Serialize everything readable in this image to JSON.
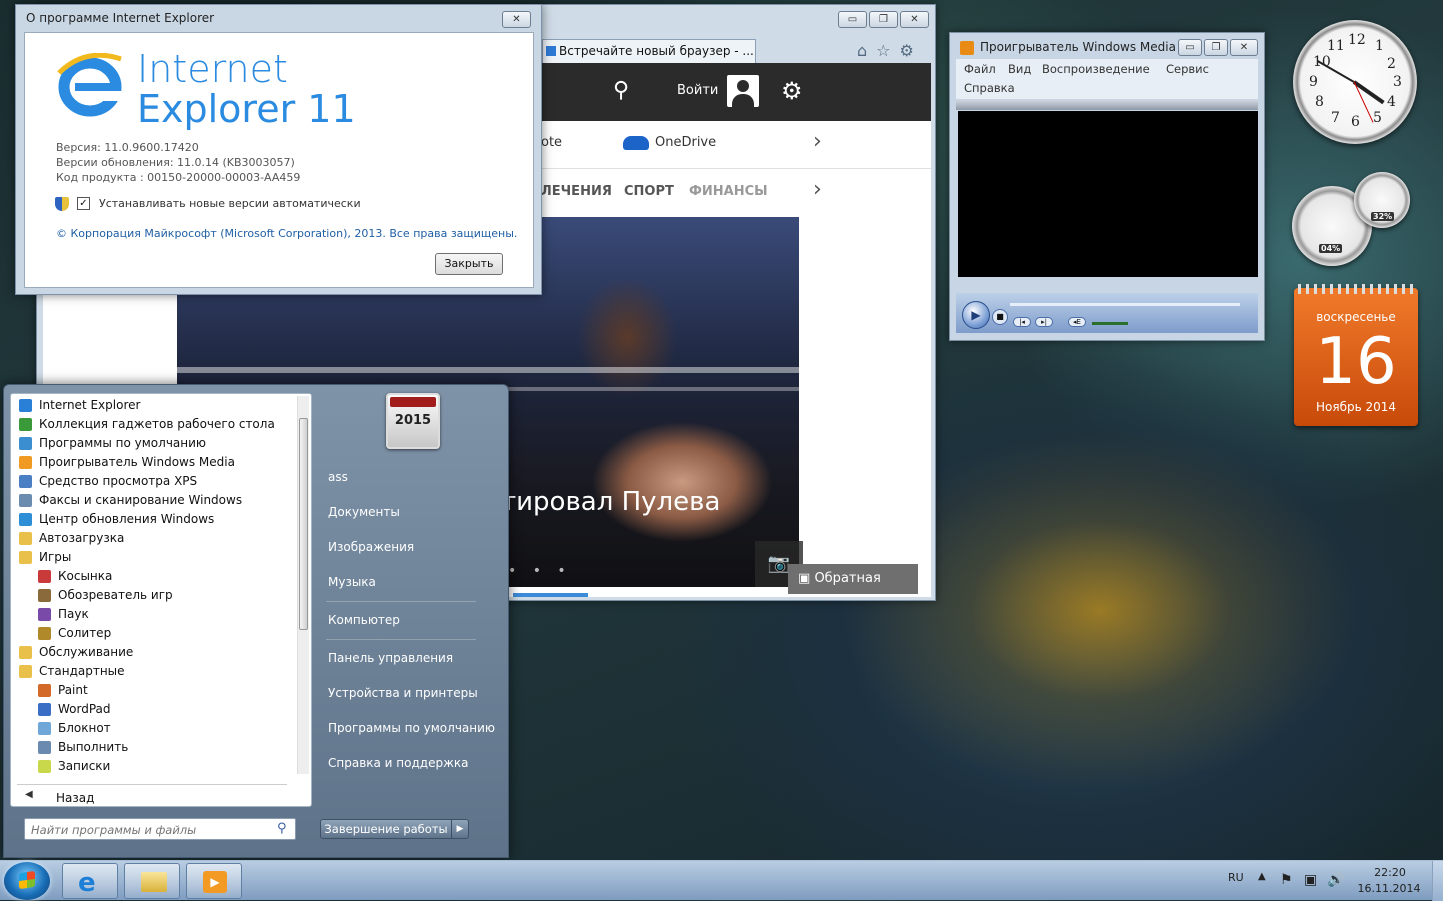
{
  "browser": {
    "tab_title": "Встречайте новый браузер - ...",
    "caption": {
      "minimize": "▭",
      "restore": "❐",
      "close": "✕"
    },
    "toolbar_icons": [
      "home-icon",
      "star-icon",
      "gear-icon"
    ],
    "toolbar_glyphs": {
      "home": "⌂",
      "favorites": "☆",
      "settings": "⚙"
    },
    "msn": {
      "search_glyph": "⚲",
      "login": "Войти",
      "settings_glyph": "⚙",
      "apps": {
        "note": "ote",
        "onedrive": "OneDrive",
        "next": "›"
      },
      "nav": {
        "entertainment": "ЛЕЧЕНИЯ",
        "sport": "СПОРТ",
        "finance": "ФИНАНСЫ",
        "next": "›"
      },
      "hero_caption": "тировал Пулева",
      "hero_dots": "• • •",
      "camera_glyph": "📷",
      "feedback": "Обратная связь",
      "feedback_glyph": "▣"
    }
  },
  "about": {
    "title": "О программе Internet Explorer",
    "close_x": "✕",
    "wordmark_line1": "Internet",
    "wordmark_line2": "Explorer 11",
    "version": "Версия: 11.0.9600.17420",
    "update_version": "Версии обновления: 11.0.14 (KB3003057)",
    "product_code": "Код продукта : 00150-20000-00003-AA459",
    "autoupdate_checked": "✓",
    "autoupdate_label": "Устанавливать новые версии автоматически",
    "copyright": "© Корпорация Майкрософт (Microsoft Corporation), 2013. Все права защищены.",
    "close_button": "Закрыть"
  },
  "wmp": {
    "title": "Проигрыватель Windows Media",
    "caption": {
      "minimize": "▭",
      "restore": "❐",
      "close": "✕"
    },
    "menu": [
      "Файл",
      "Вид",
      "Воспроизведение",
      "Сервис",
      "Справка"
    ],
    "controls": {
      "play": "▶",
      "stop": "■",
      "prev": "|◂",
      "next": "▸|",
      "mute": "◂E"
    }
  },
  "gadgets": {
    "clock_numbers": [
      "12",
      "1",
      "2",
      "3",
      "4",
      "5",
      "6",
      "7",
      "8",
      "9",
      "10",
      "11"
    ],
    "cpu_percent": "04%",
    "memory_percent": "32%",
    "calendar": {
      "weekday": "воскресенье",
      "day": "16",
      "month": "Ноябрь 2014"
    }
  },
  "start_menu": {
    "programs": [
      {
        "label": "Internet Explorer",
        "indent": 0,
        "color": "#2a7fd6"
      },
      {
        "label": "Коллекция гаджетов рабочего стола",
        "indent": 0,
        "color": "#3a9a3a"
      },
      {
        "label": "Программы по умолчанию",
        "indent": 0,
        "color": "#3b8ed0"
      },
      {
        "label": "Проигрыватель Windows Media",
        "indent": 0,
        "color": "#f09a24"
      },
      {
        "label": "Средство просмотра XPS",
        "indent": 0,
        "color": "#4a7fc4"
      },
      {
        "label": "Факсы и сканирование Windows",
        "indent": 0,
        "color": "#6c8caf"
      },
      {
        "label": "Центр обновления Windows",
        "indent": 0,
        "color": "#2f8fd6"
      },
      {
        "label": "Автозагрузка",
        "indent": 0,
        "color": "#e8c04a"
      },
      {
        "label": "Игры",
        "indent": 0,
        "color": "#e8c04a"
      },
      {
        "label": "Косынка",
        "indent": 1,
        "color": "#c93a3a"
      },
      {
        "label": "Обозреватель игр",
        "indent": 1,
        "color": "#8a6a3a"
      },
      {
        "label": "Паук",
        "indent": 1,
        "color": "#7a4aa8"
      },
      {
        "label": "Солитер",
        "indent": 1,
        "color": "#b08a2a"
      },
      {
        "label": "Обслуживание",
        "indent": 0,
        "color": "#e8c04a"
      },
      {
        "label": "Стандартные",
        "indent": 0,
        "color": "#e8c04a"
      },
      {
        "label": "Paint",
        "indent": 1,
        "color": "#d46a2a"
      },
      {
        "label": "WordPad",
        "indent": 1,
        "color": "#3a6ec4"
      },
      {
        "label": "Блокнот",
        "indent": 1,
        "color": "#6fa8d8"
      },
      {
        "label": "Выполнить",
        "indent": 1,
        "color": "#6a8ab0"
      },
      {
        "label": "Записки",
        "indent": 1,
        "color": "#c8d84a"
      }
    ],
    "back_arrow": "◀",
    "back": "Назад",
    "search_placeholder": "Найти программы и файлы",
    "search_glyph": "⚲",
    "user_tile_year": "2015",
    "right": {
      "user": "ass",
      "documents": "Документы",
      "pictures": "Изображения",
      "music": "Музыка",
      "computer": "Компьютер",
      "control_panel": "Панель управления",
      "devices": "Устройства и принтеры",
      "default_programs": "Программы по умолчанию",
      "help": "Справка и поддержка"
    },
    "shutdown": "Завершение работы",
    "shutdown_arrow": "▶"
  },
  "taskbar": {
    "ie_glyph": "e",
    "wmp_glyph": "▶",
    "lang": "RU",
    "tray_up": "▲",
    "tray_glyphs": {
      "flag": "⚑",
      "network": "▣",
      "volume": "🔊"
    },
    "time": "22:20",
    "date": "16.11.2014"
  }
}
